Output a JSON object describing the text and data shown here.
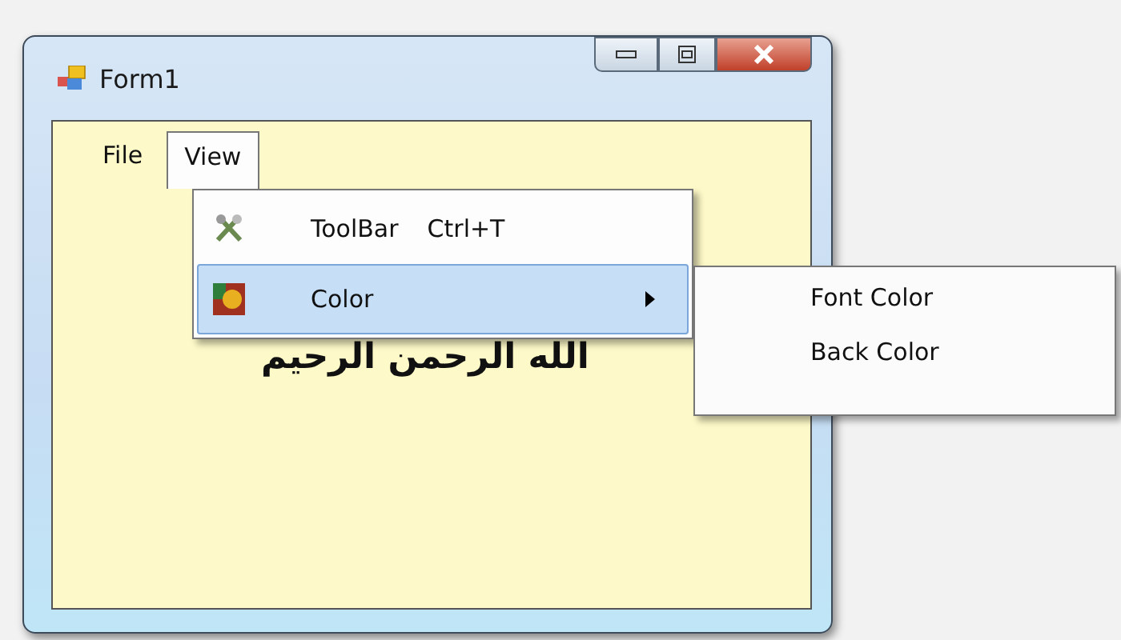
{
  "window": {
    "title": "Form1"
  },
  "menu_bar": [
    {
      "label": "File",
      "selected": false
    },
    {
      "label": "View",
      "selected": true
    }
  ],
  "view_menu": [
    {
      "label": "ToolBar",
      "shortcut": "Ctrl+T",
      "selected": false,
      "has_submenu": false
    },
    {
      "label": "Color",
      "selected": true,
      "has_submenu": true
    }
  ],
  "color_submenu": [
    {
      "label": "Font Color"
    },
    {
      "label": "Back Color"
    }
  ],
  "content": {
    "text": "الله الرحمن الرحيم"
  }
}
